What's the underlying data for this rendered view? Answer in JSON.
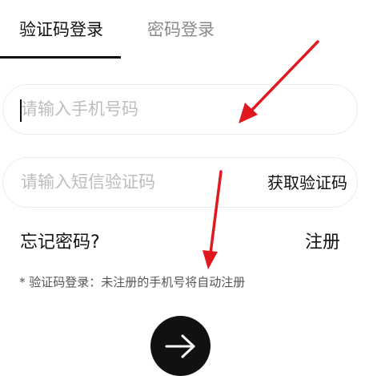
{
  "tabs": [
    {
      "label": "验证码登录",
      "active": true
    },
    {
      "label": "密码登录",
      "active": false
    }
  ],
  "phone": {
    "placeholder": "请输入手机号码",
    "value": ""
  },
  "code": {
    "placeholder": "请输入短信验证码",
    "value": "",
    "get_code_label": "获取验证码"
  },
  "links": {
    "forgot": "忘记密码?",
    "register": "注册"
  },
  "hint": "* 验证码登录：未注册的手机号将自动注册",
  "submit": {
    "icon": "arrow-right-icon"
  },
  "annotation": {
    "arrow_color": "#e0191f"
  },
  "colors": {
    "primary": "#111111",
    "placeholder": "#bdbdbd",
    "muted_tab": "#8a8a8a"
  }
}
